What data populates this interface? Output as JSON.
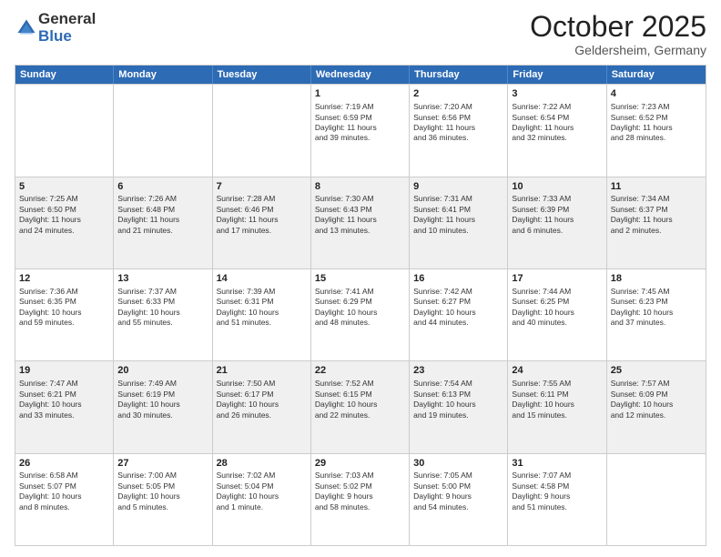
{
  "logo": {
    "general": "General",
    "blue": "Blue"
  },
  "header": {
    "month": "October 2025",
    "location": "Geldersheim, Germany"
  },
  "weekdays": [
    "Sunday",
    "Monday",
    "Tuesday",
    "Wednesday",
    "Thursday",
    "Friday",
    "Saturday"
  ],
  "rows": [
    [
      {
        "day": "",
        "text": "",
        "shaded": false
      },
      {
        "day": "",
        "text": "",
        "shaded": false
      },
      {
        "day": "",
        "text": "",
        "shaded": false
      },
      {
        "day": "1",
        "text": "Sunrise: 7:19 AM\nSunset: 6:59 PM\nDaylight: 11 hours\nand 39 minutes.",
        "shaded": false
      },
      {
        "day": "2",
        "text": "Sunrise: 7:20 AM\nSunset: 6:56 PM\nDaylight: 11 hours\nand 36 minutes.",
        "shaded": false
      },
      {
        "day": "3",
        "text": "Sunrise: 7:22 AM\nSunset: 6:54 PM\nDaylight: 11 hours\nand 32 minutes.",
        "shaded": false
      },
      {
        "day": "4",
        "text": "Sunrise: 7:23 AM\nSunset: 6:52 PM\nDaylight: 11 hours\nand 28 minutes.",
        "shaded": false
      }
    ],
    [
      {
        "day": "5",
        "text": "Sunrise: 7:25 AM\nSunset: 6:50 PM\nDaylight: 11 hours\nand 24 minutes.",
        "shaded": true
      },
      {
        "day": "6",
        "text": "Sunrise: 7:26 AM\nSunset: 6:48 PM\nDaylight: 11 hours\nand 21 minutes.",
        "shaded": true
      },
      {
        "day": "7",
        "text": "Sunrise: 7:28 AM\nSunset: 6:46 PM\nDaylight: 11 hours\nand 17 minutes.",
        "shaded": true
      },
      {
        "day": "8",
        "text": "Sunrise: 7:30 AM\nSunset: 6:43 PM\nDaylight: 11 hours\nand 13 minutes.",
        "shaded": true
      },
      {
        "day": "9",
        "text": "Sunrise: 7:31 AM\nSunset: 6:41 PM\nDaylight: 11 hours\nand 10 minutes.",
        "shaded": true
      },
      {
        "day": "10",
        "text": "Sunrise: 7:33 AM\nSunset: 6:39 PM\nDaylight: 11 hours\nand 6 minutes.",
        "shaded": true
      },
      {
        "day": "11",
        "text": "Sunrise: 7:34 AM\nSunset: 6:37 PM\nDaylight: 11 hours\nand 2 minutes.",
        "shaded": true
      }
    ],
    [
      {
        "day": "12",
        "text": "Sunrise: 7:36 AM\nSunset: 6:35 PM\nDaylight: 10 hours\nand 59 minutes.",
        "shaded": false
      },
      {
        "day": "13",
        "text": "Sunrise: 7:37 AM\nSunset: 6:33 PM\nDaylight: 10 hours\nand 55 minutes.",
        "shaded": false
      },
      {
        "day": "14",
        "text": "Sunrise: 7:39 AM\nSunset: 6:31 PM\nDaylight: 10 hours\nand 51 minutes.",
        "shaded": false
      },
      {
        "day": "15",
        "text": "Sunrise: 7:41 AM\nSunset: 6:29 PM\nDaylight: 10 hours\nand 48 minutes.",
        "shaded": false
      },
      {
        "day": "16",
        "text": "Sunrise: 7:42 AM\nSunset: 6:27 PM\nDaylight: 10 hours\nand 44 minutes.",
        "shaded": false
      },
      {
        "day": "17",
        "text": "Sunrise: 7:44 AM\nSunset: 6:25 PM\nDaylight: 10 hours\nand 40 minutes.",
        "shaded": false
      },
      {
        "day": "18",
        "text": "Sunrise: 7:45 AM\nSunset: 6:23 PM\nDaylight: 10 hours\nand 37 minutes.",
        "shaded": false
      }
    ],
    [
      {
        "day": "19",
        "text": "Sunrise: 7:47 AM\nSunset: 6:21 PM\nDaylight: 10 hours\nand 33 minutes.",
        "shaded": true
      },
      {
        "day": "20",
        "text": "Sunrise: 7:49 AM\nSunset: 6:19 PM\nDaylight: 10 hours\nand 30 minutes.",
        "shaded": true
      },
      {
        "day": "21",
        "text": "Sunrise: 7:50 AM\nSunset: 6:17 PM\nDaylight: 10 hours\nand 26 minutes.",
        "shaded": true
      },
      {
        "day": "22",
        "text": "Sunrise: 7:52 AM\nSunset: 6:15 PM\nDaylight: 10 hours\nand 22 minutes.",
        "shaded": true
      },
      {
        "day": "23",
        "text": "Sunrise: 7:54 AM\nSunset: 6:13 PM\nDaylight: 10 hours\nand 19 minutes.",
        "shaded": true
      },
      {
        "day": "24",
        "text": "Sunrise: 7:55 AM\nSunset: 6:11 PM\nDaylight: 10 hours\nand 15 minutes.",
        "shaded": true
      },
      {
        "day": "25",
        "text": "Sunrise: 7:57 AM\nSunset: 6:09 PM\nDaylight: 10 hours\nand 12 minutes.",
        "shaded": true
      }
    ],
    [
      {
        "day": "26",
        "text": "Sunrise: 6:58 AM\nSunset: 5:07 PM\nDaylight: 10 hours\nand 8 minutes.",
        "shaded": false
      },
      {
        "day": "27",
        "text": "Sunrise: 7:00 AM\nSunset: 5:05 PM\nDaylight: 10 hours\nand 5 minutes.",
        "shaded": false
      },
      {
        "day": "28",
        "text": "Sunrise: 7:02 AM\nSunset: 5:04 PM\nDaylight: 10 hours\nand 1 minute.",
        "shaded": false
      },
      {
        "day": "29",
        "text": "Sunrise: 7:03 AM\nSunset: 5:02 PM\nDaylight: 9 hours\nand 58 minutes.",
        "shaded": false
      },
      {
        "day": "30",
        "text": "Sunrise: 7:05 AM\nSunset: 5:00 PM\nDaylight: 9 hours\nand 54 minutes.",
        "shaded": false
      },
      {
        "day": "31",
        "text": "Sunrise: 7:07 AM\nSunset: 4:58 PM\nDaylight: 9 hours\nand 51 minutes.",
        "shaded": false
      },
      {
        "day": "",
        "text": "",
        "shaded": false
      }
    ]
  ]
}
